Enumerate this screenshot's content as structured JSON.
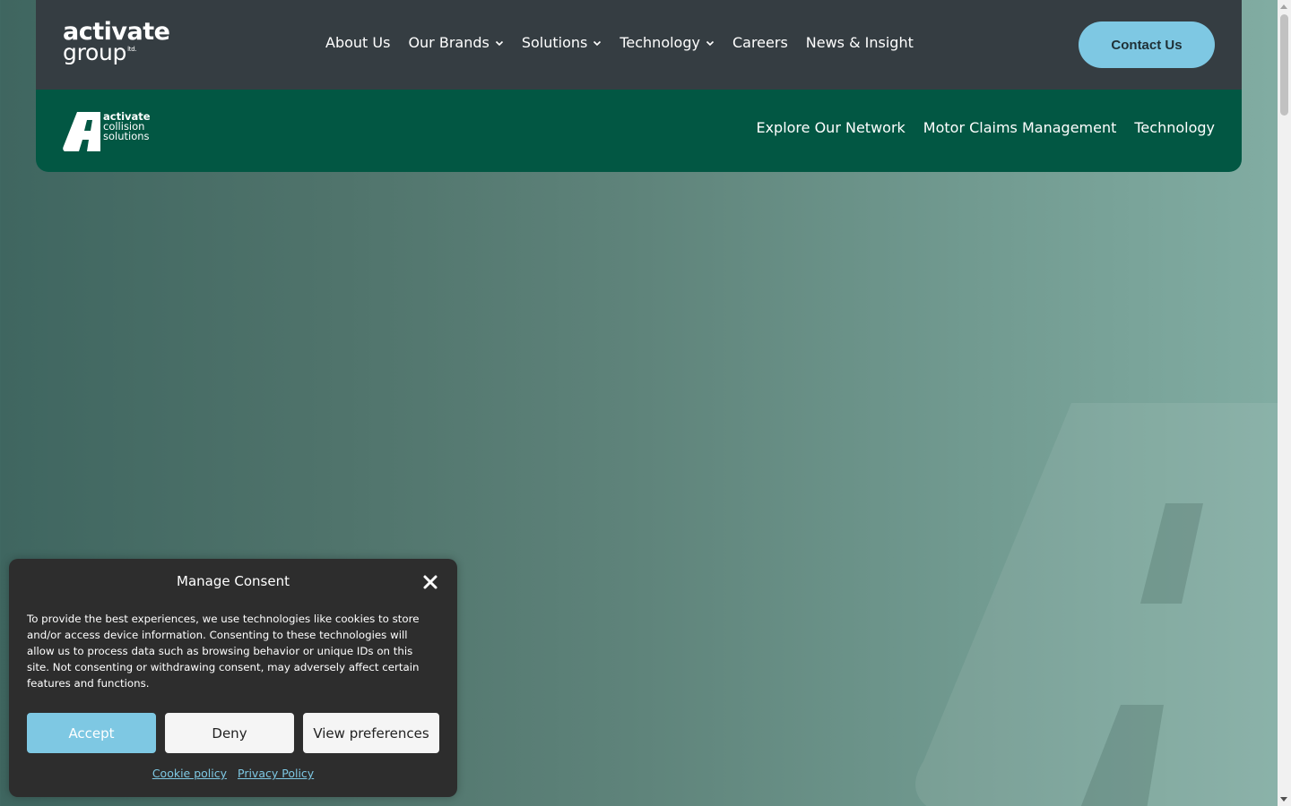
{
  "header": {
    "brand": {
      "line1": "activate",
      "line2": "group",
      "suffix": "ltd."
    },
    "nav": [
      {
        "label": "About Us",
        "dropdown": false
      },
      {
        "label": "Our Brands",
        "dropdown": true
      },
      {
        "label": "Solutions",
        "dropdown": true
      },
      {
        "label": "Technology",
        "dropdown": true
      },
      {
        "label": "Careers",
        "dropdown": false
      },
      {
        "label": "News & Insight",
        "dropdown": false
      }
    ],
    "contact_label": "Contact Us"
  },
  "subheader": {
    "logo": {
      "line1": "activate",
      "line2": "collision",
      "line3": "solutions"
    },
    "nav": [
      {
        "label": "Explore Our Network"
      },
      {
        "label": "Motor Claims Management"
      },
      {
        "label": "Technology"
      }
    ]
  },
  "consent": {
    "title": "Manage Consent",
    "body": "To provide the best experiences, we use technologies like cookies to store and/or access device information. Consenting to these technologies will allow us to process data such as browsing behavior or unique IDs on this site. Not consenting or withdrawing consent, may adversely affect certain features and functions.",
    "accept_label": "Accept",
    "deny_label": "Deny",
    "preferences_label": "View preferences",
    "links": [
      {
        "label": "Cookie policy"
      },
      {
        "label": "Privacy Policy"
      }
    ]
  },
  "colors": {
    "header_dark": "#353d42",
    "header_green": "#025743",
    "accent": "#7ec8e3",
    "dialog_bg": "#2d2d2d"
  }
}
